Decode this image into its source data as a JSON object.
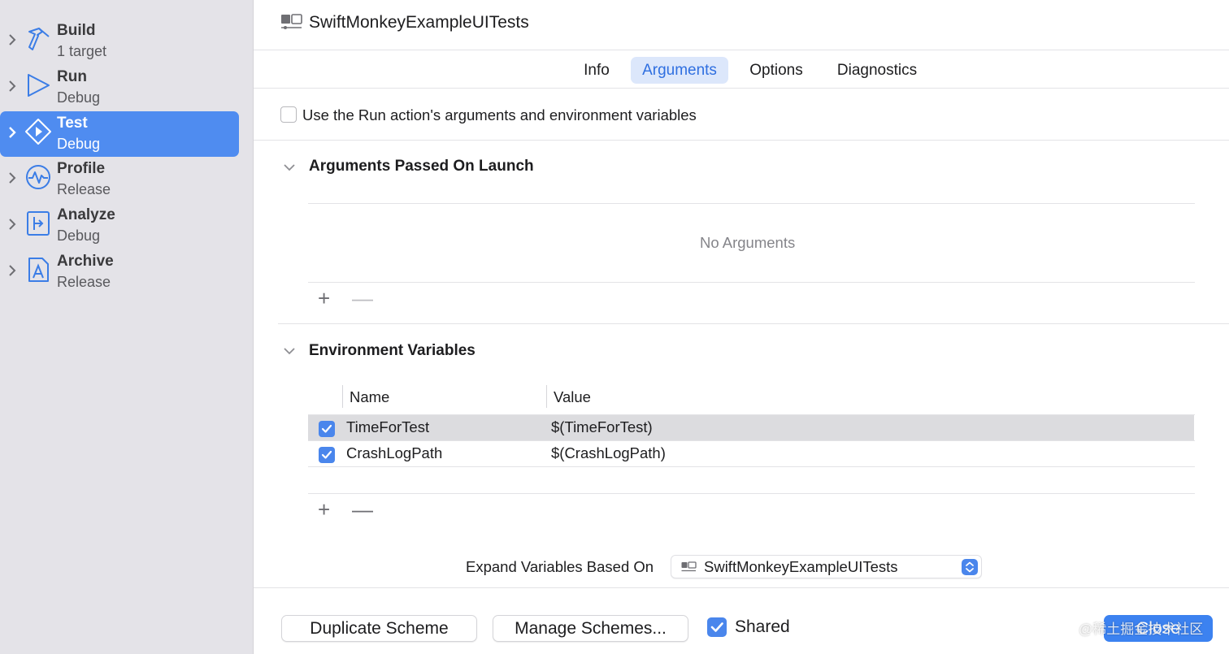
{
  "sidebar": {
    "items": [
      {
        "title": "Build",
        "subtitle": "1 target",
        "icon": "hammer-icon",
        "selected": false
      },
      {
        "title": "Run",
        "subtitle": "Debug",
        "icon": "play-icon",
        "selected": false
      },
      {
        "title": "Test",
        "subtitle": "Debug",
        "icon": "test-diamond-icon",
        "selected": true
      },
      {
        "title": "Profile",
        "subtitle": "Release",
        "icon": "waveform-icon",
        "selected": false
      },
      {
        "title": "Analyze",
        "subtitle": "Debug",
        "icon": "analyze-icon",
        "selected": false
      },
      {
        "title": "Archive",
        "subtitle": "Release",
        "icon": "archive-icon",
        "selected": false
      }
    ]
  },
  "header": {
    "title": "SwiftMonkeyExampleUITests"
  },
  "tabs": [
    {
      "label": "Info",
      "active": false
    },
    {
      "label": "Arguments",
      "active": true
    },
    {
      "label": "Options",
      "active": false
    },
    {
      "label": "Diagnostics",
      "active": false
    }
  ],
  "use_run_action": {
    "label": "Use the Run action's arguments and environment variables",
    "checked": false
  },
  "arguments_section": {
    "title": "Arguments Passed On Launch",
    "empty_text": "No Arguments",
    "add_label": "+",
    "remove_label": "—"
  },
  "env_section": {
    "title": "Environment Variables",
    "columns": {
      "name": "Name",
      "value": "Value"
    },
    "rows": [
      {
        "name": "TimeForTest",
        "value": "$(TimeForTest)",
        "checked": true,
        "selected": true
      },
      {
        "name": "CrashLogPath",
        "value": "$(CrashLogPath)",
        "checked": true,
        "selected": false
      }
    ],
    "add_label": "+",
    "remove_label": "—"
  },
  "expand_variables": {
    "label": "Expand Variables Based On",
    "selected": "SwiftMonkeyExampleUITests"
  },
  "footer": {
    "duplicate_label": "Duplicate Scheme",
    "manage_label": "Manage Schemes...",
    "shared_label": "Shared",
    "shared_checked": true,
    "close_label": "Close",
    "watermark": "@稀土掘金技术社区"
  },
  "colors": {
    "accent": "#4a86ec",
    "sidebar_selected": "#4f8cf0",
    "tab_active_bg": "#dce7fb",
    "sidebar_bg": "#e4e3e8"
  }
}
